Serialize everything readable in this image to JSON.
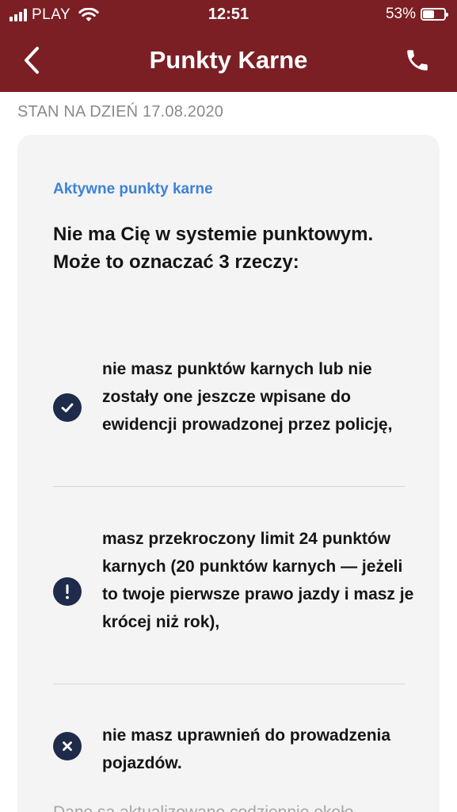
{
  "status_bar": {
    "carrier": "PLAY",
    "time": "12:51",
    "battery": "53%",
    "battery_level": 0.53
  },
  "nav": {
    "title": "Punkty Karne",
    "back_icon": "chevron-left-icon",
    "phone_icon": "phone-icon"
  },
  "date_label": "STAN NA DZIEŃ 17.08.2020",
  "card": {
    "header": "Aktywne punkty karne",
    "lead": "Nie ma Cię w systemie punktowym. Może to oznaczać 3 rzeczy:",
    "items": [
      {
        "icon": "check-icon",
        "text": "nie masz punktów karnych lub nie zostały one jeszcze wpisane do ewidencji prowadzonej przez policję,"
      },
      {
        "icon": "exclamation-icon",
        "text": "masz przekroczony limit 24 punktów karnych (20 punktów karnych — jeżeli to twoje pierwsze prawo jazdy i masz je krócej niż rok),"
      },
      {
        "icon": "close-icon",
        "text": "nie masz uprawnień do prowadzenia pojazdów."
      }
    ],
    "footnote": "Dane są aktualizowane codziennie około"
  },
  "colors": {
    "brand": "#7b1f24",
    "accent": "#3d82d9",
    "icon_bg": "#1e2b4a"
  }
}
